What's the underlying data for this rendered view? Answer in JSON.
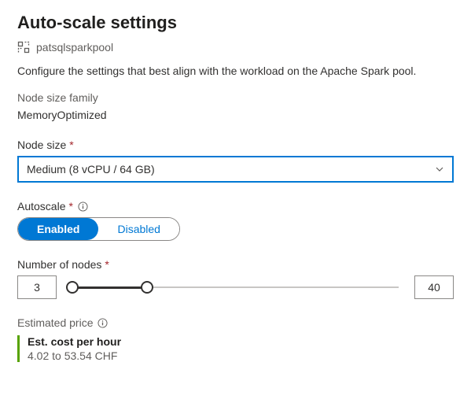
{
  "title": "Auto-scale settings",
  "pool": {
    "name": "patsqlsparkpool"
  },
  "description": "Configure the settings that best align with the workload on the Apache Spark pool.",
  "nodeSizeFamily": {
    "label": "Node size family",
    "value": "MemoryOptimized"
  },
  "nodeSize": {
    "label": "Node size",
    "value": "Medium (8 vCPU / 64 GB)"
  },
  "autoscale": {
    "label": "Autoscale",
    "enabled_label": "Enabled",
    "disabled_label": "Disabled"
  },
  "nodes": {
    "label": "Number of nodes",
    "min": "3",
    "max": "40"
  },
  "estimate": {
    "label": "Estimated price",
    "title": "Est. cost per hour",
    "value": "4.02 to 53.54 CHF"
  }
}
